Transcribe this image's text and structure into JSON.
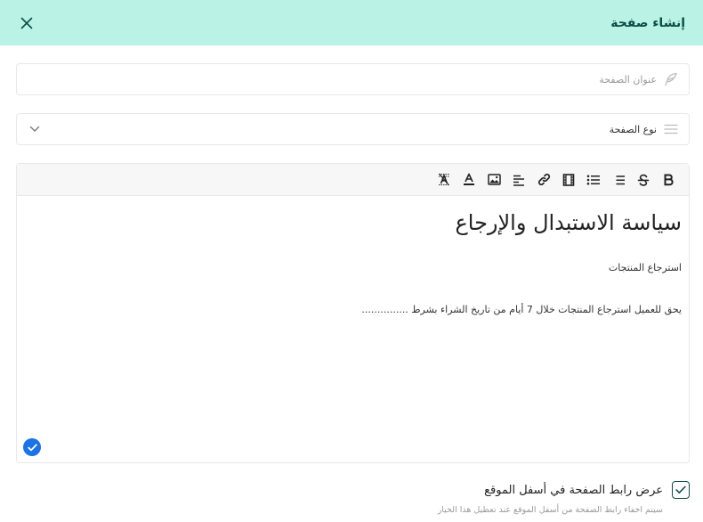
{
  "header": {
    "title": "إنشاء صفحة"
  },
  "form": {
    "page_title_placeholder": "عنوان الصفحة",
    "page_title_value": "",
    "page_type_value": "نوع الصفحة"
  },
  "editor": {
    "toolbar": [
      {
        "name": "bold-button",
        "icon": "bold-icon"
      },
      {
        "name": "strikethrough-button",
        "icon": "strikethrough-icon"
      },
      {
        "name": "ordered-list-button",
        "icon": "ordered-list-icon"
      },
      {
        "name": "bullet-list-button",
        "icon": "bullet-list-icon"
      },
      {
        "name": "video-button",
        "icon": "film-icon"
      },
      {
        "name": "link-button",
        "icon": "link-icon"
      },
      {
        "name": "align-button",
        "icon": "align-right-icon"
      },
      {
        "name": "image-button",
        "icon": "image-icon"
      },
      {
        "name": "text-color-button",
        "icon": "text-color-icon"
      },
      {
        "name": "clear-format-button",
        "icon": "clear-format-icon"
      }
    ],
    "heading": "سياسة الاستبدال والإرجاع",
    "subheading": "استرجاع المنتجات",
    "paragraph": "يحق للعميل استرجاع المنتجات خلال 7 أيام من تاريخ الشراء بشرط ..............."
  },
  "footer_option": {
    "checked": true,
    "label": "عرض رابط الصفحة في أسفل الموقع",
    "hint": "سيتم اخفاء رابط الصفحة من أسفل الموقع عند تعطيل هذا الخيار"
  },
  "colors": {
    "header_bg": "#baf2e5",
    "header_text": "#0c4d46",
    "badge": "#1a73e8"
  }
}
